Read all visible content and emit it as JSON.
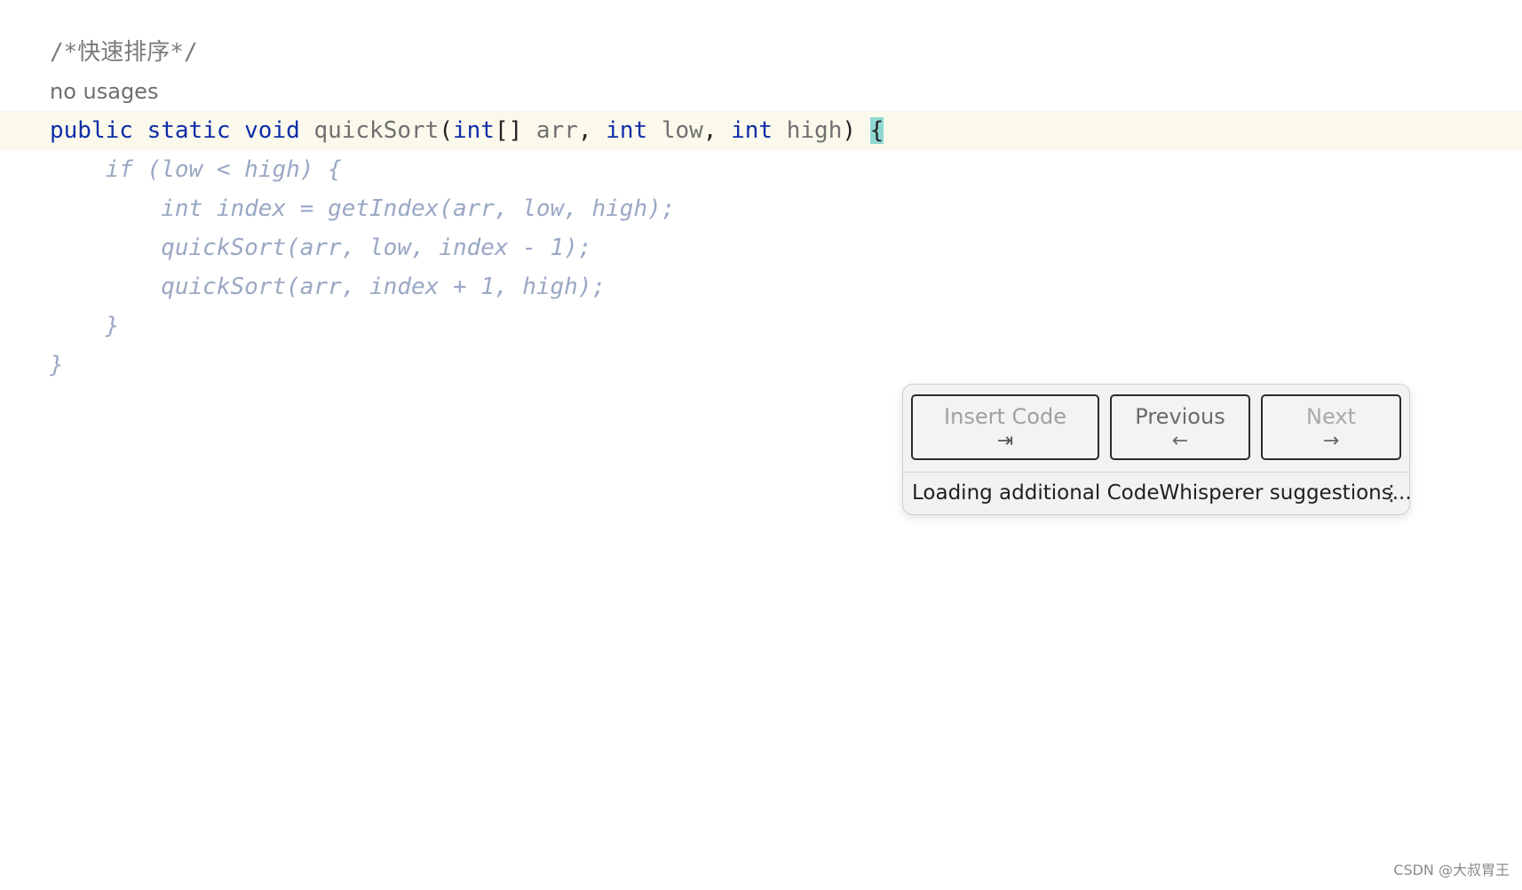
{
  "editor": {
    "comment": "/*快速排序*/",
    "usages_hint": "no usages",
    "signature": {
      "kw_public": "public",
      "kw_static": "static",
      "kw_void": "void",
      "method_name": "quickSort",
      "paren_open": "(",
      "type_int_array": "int",
      "brackets": "[]",
      "param_arr": "arr",
      "comma1": ",",
      "type_int_1": "int",
      "param_low": "low",
      "comma2": ",",
      "type_int_2": "int",
      "param_high": "high",
      "paren_close": ")",
      "open_brace": "{"
    },
    "suggestion_lines": [
      "    if (low < high) {",
      "        int index = getIndex(arr, low, high);",
      "        quickSort(arr, low, index - 1);",
      "        quickSort(arr, index + 1, high);",
      "    }",
      "}"
    ]
  },
  "popup": {
    "insert_label": "Insert Code",
    "insert_symbol": "⇥",
    "previous_label": "Previous",
    "previous_symbol": "←",
    "next_label": "Next",
    "next_symbol": "→",
    "status_text": "Loading additional CodeWhisperer suggestions...",
    "more_symbol": "⋮"
  },
  "watermark": "CSDN @大叔胃王",
  "colors": {
    "keyword": "#0f2ea8",
    "ghost_text": "#9aa8c4",
    "current_line": "#fbf9ec",
    "brace_highlight": "#8fd8d2"
  }
}
